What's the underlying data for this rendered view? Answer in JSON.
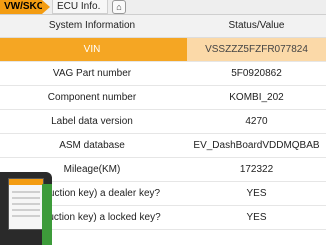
{
  "tabs": {
    "brand_label": "VW/SKODA/S...",
    "ecu_label": "ECU Info."
  },
  "header": {
    "col1": "System Information",
    "col2": "Status/Value"
  },
  "rows": [
    {
      "label": "VIN",
      "value": "VSSZZZ5FZFR077824"
    },
    {
      "label": "VAG Part number",
      "value": "5F0920862"
    },
    {
      "label": "Component number",
      "value": "KOMBI_202"
    },
    {
      "label": "Label data version",
      "value": "4270"
    },
    {
      "label": "ASM database",
      "value": "EV_DashBoardVDDMQBAB"
    },
    {
      "label": "Mileage(KM)",
      "value": "172322"
    },
    {
      "label": "or induction key) a dealer key?",
      "value": "YES"
    },
    {
      "label": "or induction key) a locked key?",
      "value": "YES"
    }
  ],
  "colors": {
    "accent": "#f39c12",
    "selected_row": "#f5a623"
  }
}
